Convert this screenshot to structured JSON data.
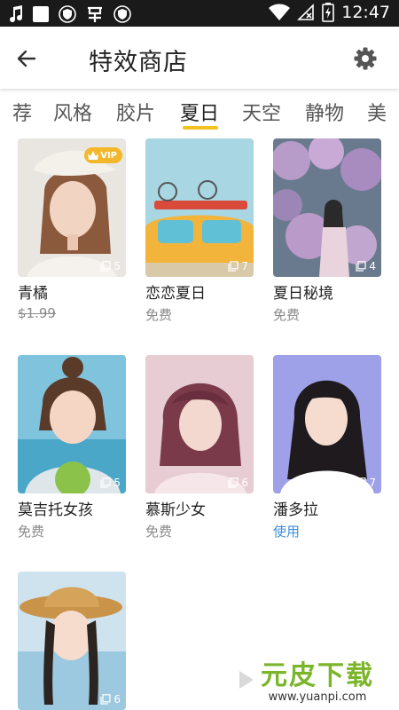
{
  "status_bar": {
    "time": "12:47",
    "left_icons": [
      "music-note-icon",
      "white-square-icon",
      "shield-icon",
      "bug-icon",
      "shield-icon"
    ],
    "right_icons": [
      "wifi-icon",
      "no-sim-icon",
      "battery-charging-icon"
    ]
  },
  "app_bar": {
    "title": "特效商店",
    "back_icon": "arrow-left-icon",
    "settings_icon": "gear-icon"
  },
  "tabs": {
    "items": [
      "荐",
      "风格",
      "胶片",
      "夏日",
      "天空",
      "静物",
      "美"
    ],
    "active_index": 3,
    "accent_color": "#f2c320"
  },
  "grid": {
    "items": [
      {
        "name": "青橘",
        "price": "$1.99",
        "price_style": "strikethrough",
        "count": "5",
        "vip": "VIP"
      },
      {
        "name": "恋恋夏日",
        "price": "免费",
        "price_style": "normal",
        "count": "7"
      },
      {
        "name": "夏日秘境",
        "price": "免费",
        "price_style": "normal",
        "count": "4"
      },
      {
        "name": "莫吉托女孩",
        "price": "免费",
        "price_style": "normal",
        "count": "5"
      },
      {
        "name": "慕斯少女",
        "price": "免费",
        "price_style": "normal",
        "count": "6"
      },
      {
        "name": "潘多拉",
        "price": "使用",
        "price_style": "link",
        "price_color": "#3d8fe0",
        "count": "7"
      },
      {
        "name": "",
        "price": "",
        "count": "6"
      }
    ]
  },
  "watermark": {
    "logo": "元皮下载",
    "url": "www.yuanpi.com"
  }
}
